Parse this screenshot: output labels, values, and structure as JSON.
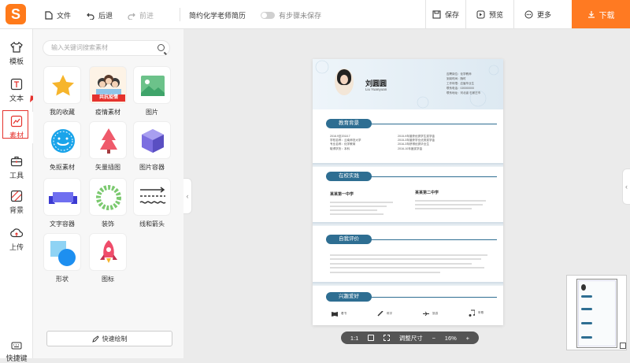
{
  "app": {
    "logo_letter": "S",
    "brand_color": "#ff7a1a"
  },
  "toolbar": {
    "file": "文件",
    "undo": "后退",
    "redo": "前进",
    "doc_title": "简约化学老师简历",
    "autosave": "有步骤未保存",
    "save": "保存",
    "preview": "预览",
    "more": "更多",
    "download": "下载"
  },
  "rail": [
    {
      "label": "模板",
      "icon": "tshirt-icon"
    },
    {
      "label": "文本",
      "icon": "text-icon"
    },
    {
      "label": "素材",
      "icon": "material-icon",
      "active": true
    },
    {
      "label": "工具",
      "icon": "toolbox-icon"
    },
    {
      "label": "背景",
      "icon": "background-icon"
    },
    {
      "label": "上传",
      "icon": "upload-icon"
    }
  ],
  "shortcut": "快捷键",
  "panel": {
    "search_placeholder": "输入关键词搜索素材",
    "categories": [
      {
        "label": "我的收藏",
        "icon": "star-icon"
      },
      {
        "label": "疫情素材",
        "icon": "epidemic-icon",
        "badge": "共抗疫情"
      },
      {
        "label": "图片",
        "icon": "image-icon"
      },
      {
        "label": "免抠素材",
        "icon": "cutout-icon"
      },
      {
        "label": "矢量插图",
        "icon": "vector-icon"
      },
      {
        "label": "图片容器",
        "icon": "cube-icon"
      },
      {
        "label": "文字容器",
        "icon": "ribbon-icon"
      },
      {
        "label": "装饰",
        "icon": "wreath-icon"
      },
      {
        "label": "线和箭头",
        "icon": "arrow-lines-icon"
      },
      {
        "label": "形状",
        "icon": "shape-icon"
      },
      {
        "label": "图标",
        "icon": "rocket-icon"
      }
    ],
    "quick_draw": "快速绘制"
  },
  "resume": {
    "name": "刘圆圆",
    "pinyin": "Liu Yuanyuan",
    "info": [
      "应聘岗位：化学教师",
      "到岗时间：随时",
      "工作年限：应届毕业生",
      "联系电话：020000000",
      "联系地址：河北省·石家庄市"
    ],
    "sections": {
      "edu": "教育背景",
      "edu_left": [
        "2016.9至2018.7",
        "学校名称：云南师范大学",
        "专业名称：化学教育",
        "取得学历：本科"
      ],
      "edu_right": [
        "2015-9年曾获优秀学生奖学金",
        "2015-3年曾获学业优秀奖学金",
        "2016-3年获得优秀毕业生",
        "2016-10年度奖学金"
      ],
      "practice": "在校实践",
      "practice_left_title": "某某第一中学",
      "practice_right_title": "某某第二中学",
      "self": "自我评价",
      "hobby": "兴趣爱好",
      "hobbies": [
        "看书",
        "练字",
        "旅游",
        "听歌"
      ]
    }
  },
  "zoom": {
    "ratio": "1:1",
    "fit": "调整尺寸",
    "minus": "−",
    "value": "16%",
    "plus": "+"
  },
  "colors": {
    "accent": "#ff7a22",
    "section": "#2e6e92",
    "highlight": "#e5322d"
  }
}
